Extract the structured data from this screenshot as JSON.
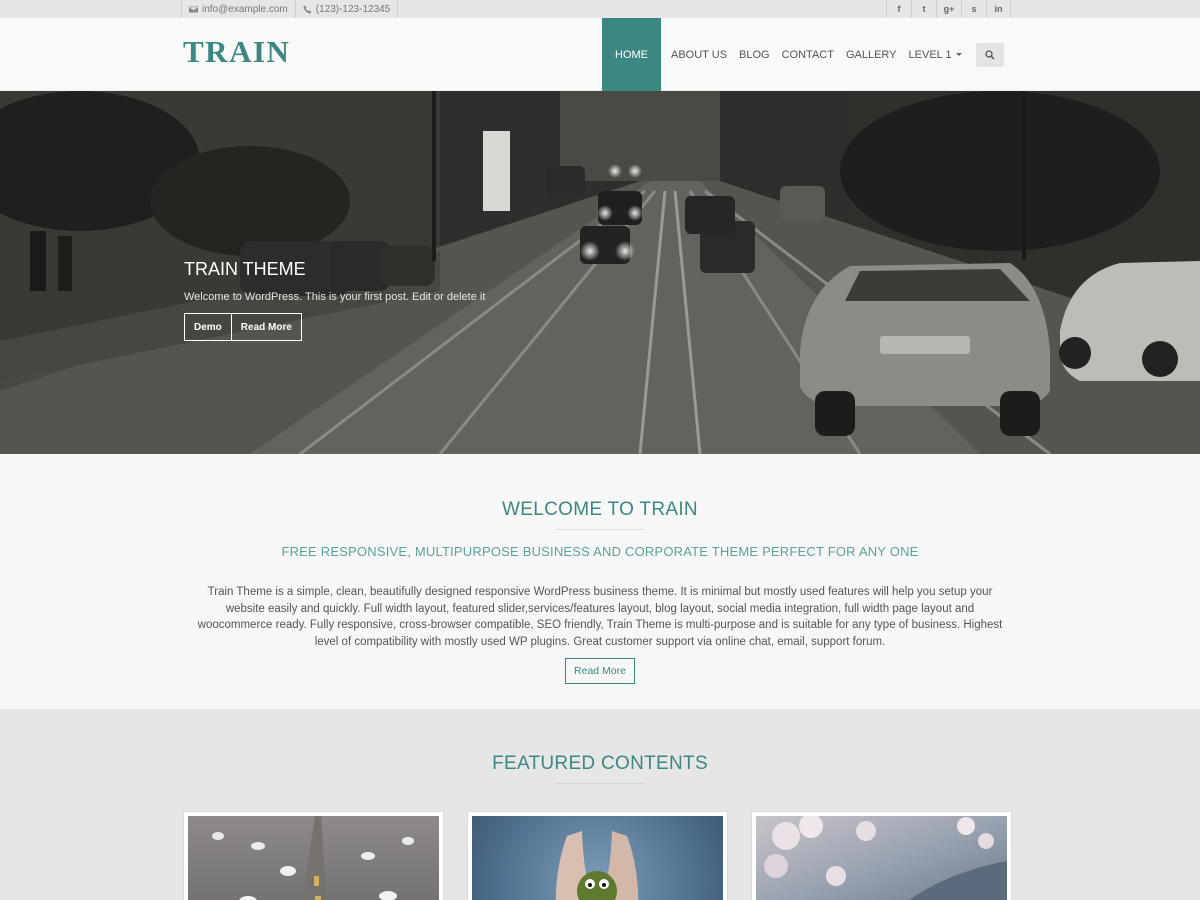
{
  "topbar": {
    "email": "info@example.com",
    "phone": "(123)-123-12345",
    "social": [
      {
        "label": "f",
        "icon": "facebook-icon"
      },
      {
        "label": "t",
        "icon": "twitter-icon"
      },
      {
        "label": "g+",
        "icon": "google-plus-icon"
      },
      {
        "label": "s",
        "icon": "skype-icon"
      },
      {
        "label": "in",
        "icon": "linkedin-icon"
      }
    ]
  },
  "header": {
    "logo": "TRAIN",
    "nav": [
      "HOME",
      "ABOUT US",
      "BLOG",
      "CONTACT",
      "GALLERY",
      "LEVEL 1"
    ],
    "active_nav": "HOME"
  },
  "hero": {
    "title": "TRAIN THEME",
    "text": "Welcome to WordPress. This is your first post. Edit or delete it",
    "demo_label": "Demo",
    "read_more_label": "Read More"
  },
  "welcome": {
    "title": "WELCOME TO TRAIN",
    "subtitle": "FREE RESPONSIVE, MULTIPURPOSE BUSINESS AND CORPORATE THEME PERFECT FOR ANY ONE",
    "body": "Train Theme is a simple, clean, beautifully designed responsive WordPress business theme. It is minimal but mostly used features will help you setup your website easily and quickly. Full width layout, featured slider,services/features layout, blog layout, social media integration, full width page layout and woocommerce ready. Fully responsive, cross-browser compatible, SEO friendly, Train Theme is multi-purpose and is suitable for any type of business. Highest level of compatibility with mostly used WP plugins. Great customer support via online chat, email, support forum.",
    "button": "Read More"
  },
  "featured": {
    "title": "FEATURED CONTENTS"
  },
  "colors": {
    "accent": "#3d8783",
    "accent_light": "#5aa29d",
    "topbar_bg": "#e6e6e6",
    "featured_bg": "#e6e6e6"
  }
}
